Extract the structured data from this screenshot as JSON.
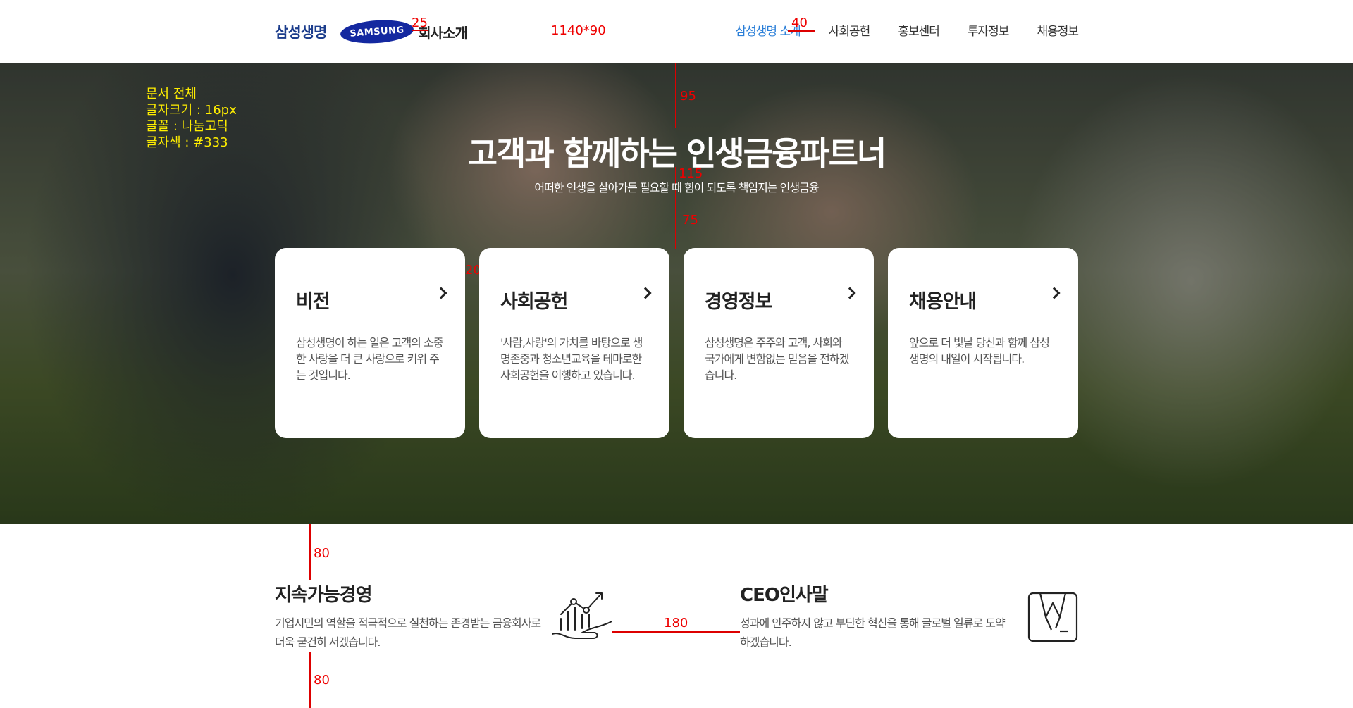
{
  "header": {
    "logo_text": "삼성생명",
    "samsung_logo": "SAMSUNG",
    "company_intro": "회사소개",
    "nav": [
      {
        "label": "삼성생명 소개",
        "active": true
      },
      {
        "label": "사회공헌"
      },
      {
        "label": "홍보센터"
      },
      {
        "label": "투자정보"
      },
      {
        "label": "채용정보"
      }
    ]
  },
  "annotations": {
    "header_size": "1140*90",
    "logo_gap": "25",
    "nav_gap": "40",
    "hero_top": "95",
    "title_gap": "115",
    "cards_gap": "75",
    "card_gap": "20",
    "section_top": "80",
    "item_gap": "180",
    "section_bottom": "80",
    "doc_note": [
      "문서 전체",
      "글자크기 : 16px",
      "글꼴 : 나눔고딕",
      "글자색 : #333"
    ]
  },
  "hero": {
    "title": "고객과 함께하는 인생금융파트너",
    "subtitle": "어떠한 인생을 살아가든 필요할 때 힘이 되도록 책임지는 인생금융"
  },
  "cards": [
    {
      "title": "비전",
      "desc": "삼성생명이 하는 일은 고객의 소중한 사랑을 더 큰 사랑으로 키워 주는 것입니다."
    },
    {
      "title": "사회공헌",
      "desc": "'사람,사랑'의 가치를 바탕으로 생명존중과 청소년교육을 테마로한 사회공헌을 이행하고 있습니다."
    },
    {
      "title": "경영정보",
      "desc": "삼성생명은 주주와 고객, 사회와 국가에게 변함없는 믿음을 전하겠습니다."
    },
    {
      "title": "채용안내",
      "desc": "앞으로 더 빛날 당신과 함께 삼성생명의 내일이 시작됩니다."
    }
  ],
  "bottom": {
    "sustainable": {
      "title": "지속가능경영",
      "desc": "기업시민의 역할을 적극적으로 실천하는 존경받는 금융회사로 더욱 굳건히 서겠습니다.",
      "icon": "growth-hand-icon"
    },
    "ceo": {
      "title": "CEO인사말",
      "desc": "성과에 안주하지 않고 부단한 혁신을 통해 글로벌 일류로 도약하겠습니다.",
      "icon": "suit-icon"
    }
  }
}
